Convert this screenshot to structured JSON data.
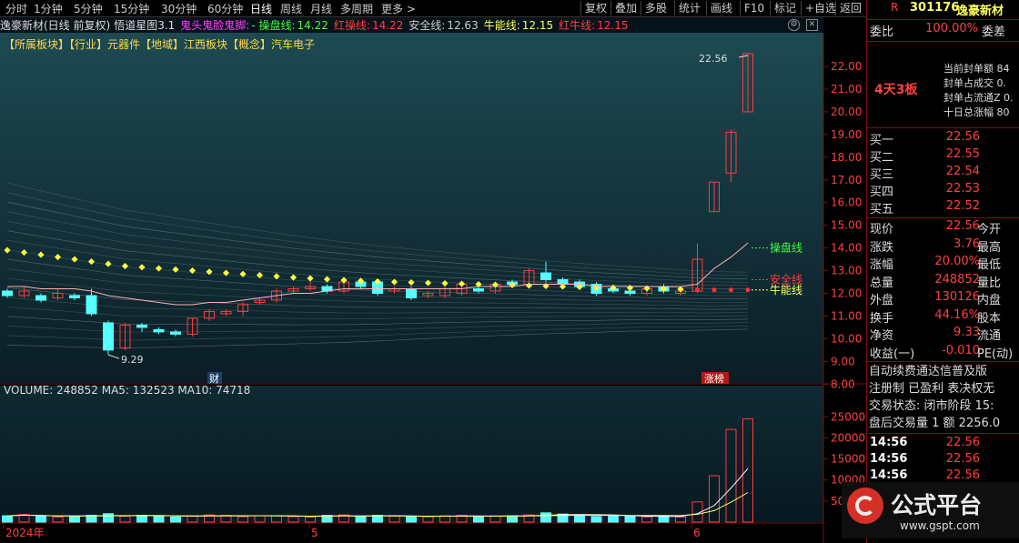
{
  "toolbar": {
    "periods": [
      "分时",
      "1分钟",
      "5分钟",
      "15分钟",
      "30分钟",
      "60分钟",
      "日线",
      "周线",
      "月线",
      "多周期",
      "更多 >"
    ],
    "buttons": [
      "复权",
      "叠加",
      "多股",
      "统计",
      "画线",
      "F10",
      "标记",
      "+自选",
      "返回"
    ]
  },
  "title": {
    "stock": "逸豪新材(日线 前复权)",
    "indicator": "悟道星图3.1",
    "formula_name": "鬼头鬼脸鬼脚:",
    "caopan_label": "- 操盘线:",
    "caopan_value": "14.22",
    "hongcao_label": "红操线:",
    "hongcao_value": "14.22",
    "anquan_label": "安全线:",
    "anquan_value": "12.63",
    "niuneng_label": "牛能线:",
    "niuneng_value": "12.15",
    "hongniu_label": "红牛线:",
    "hongniu_value": "12.15"
  },
  "tags": "【所属板块】【行业】元器件【地域】江西板块【概念】汽车电子",
  "chart_data": {
    "type": "candlestick",
    "price_axis": {
      "min": 8.0,
      "max": 22.0,
      "ticks": [
        "22.00",
        "21.00",
        "20.00",
        "19.00",
        "18.00",
        "17.00",
        "16.00",
        "15.00",
        "14.00",
        "13.00",
        "12.00",
        "11.00",
        "10.00",
        "9.00",
        "8.00"
      ]
    },
    "candles": [
      {
        "o": 12.1,
        "c": 11.9,
        "h": 12.2,
        "l": 11.8
      },
      {
        "o": 11.9,
        "c": 12.1,
        "h": 12.3,
        "l": 11.8
      },
      {
        "o": 11.9,
        "c": 11.7,
        "h": 12.0,
        "l": 11.6
      },
      {
        "o": 11.8,
        "c": 12.0,
        "h": 12.2,
        "l": 11.7
      },
      {
        "o": 11.9,
        "c": 11.8,
        "h": 12.0,
        "l": 11.7
      },
      {
        "o": 11.9,
        "c": 11.1,
        "h": 12.2,
        "l": 11.0
      },
      {
        "o": 10.7,
        "c": 9.5,
        "h": 10.8,
        "l": 9.3
      },
      {
        "o": 9.6,
        "c": 10.6,
        "h": 10.7,
        "l": 9.5
      },
      {
        "o": 10.6,
        "c": 10.5,
        "h": 10.7,
        "l": 10.3
      },
      {
        "o": 10.4,
        "c": 10.3,
        "h": 10.5,
        "l": 10.2
      },
      {
        "o": 10.3,
        "c": 10.2,
        "h": 10.4,
        "l": 10.1
      },
      {
        "o": 10.2,
        "c": 10.9,
        "h": 10.9,
        "l": 10.1
      },
      {
        "o": 10.9,
        "c": 11.2,
        "h": 11.3,
        "l": 10.8
      },
      {
        "o": 11.1,
        "c": 11.2,
        "h": 11.3,
        "l": 11.0
      },
      {
        "o": 11.2,
        "c": 11.5,
        "h": 11.6,
        "l": 11.0
      },
      {
        "o": 11.6,
        "c": 11.7,
        "h": 11.8,
        "l": 11.5
      },
      {
        "o": 11.7,
        "c": 12.1,
        "h": 12.2,
        "l": 11.6
      },
      {
        "o": 12.1,
        "c": 12.2,
        "h": 12.3,
        "l": 12.0
      },
      {
        "o": 12.2,
        "c": 12.3,
        "h": 12.5,
        "l": 12.1
      },
      {
        "o": 12.3,
        "c": 12.1,
        "h": 12.4,
        "l": 12.0
      },
      {
        "o": 12.1,
        "c": 12.5,
        "h": 12.6,
        "l": 12.0
      },
      {
        "o": 12.5,
        "c": 12.3,
        "h": 12.6,
        "l": 12.2
      },
      {
        "o": 12.5,
        "c": 12.0,
        "h": 12.6,
        "l": 11.9
      },
      {
        "o": 12.1,
        "c": 12.2,
        "h": 12.3,
        "l": 12.0
      },
      {
        "o": 12.2,
        "c": 11.8,
        "h": 12.3,
        "l": 11.7
      },
      {
        "o": 11.9,
        "c": 12.0,
        "h": 12.1,
        "l": 11.8
      },
      {
        "o": 11.9,
        "c": 12.2,
        "h": 12.3,
        "l": 11.8
      },
      {
        "o": 12.0,
        "c": 12.4,
        "h": 12.5,
        "l": 11.9
      },
      {
        "o": 12.2,
        "c": 12.1,
        "h": 12.3,
        "l": 12.0
      },
      {
        "o": 12.1,
        "c": 12.4,
        "h": 12.5,
        "l": 12.0
      },
      {
        "o": 12.5,
        "c": 12.4,
        "h": 12.6,
        "l": 12.3
      },
      {
        "o": 12.4,
        "c": 13.0,
        "h": 13.1,
        "l": 12.3
      },
      {
        "o": 12.9,
        "c": 12.6,
        "h": 13.4,
        "l": 12.5
      },
      {
        "o": 12.6,
        "c": 12.4,
        "h": 12.7,
        "l": 12.2
      },
      {
        "o": 12.5,
        "c": 12.3,
        "h": 12.6,
        "l": 12.2
      },
      {
        "o": 12.4,
        "c": 12.0,
        "h": 12.5,
        "l": 11.9
      },
      {
        "o": 12.2,
        "c": 12.1,
        "h": 12.3,
        "l": 12.0
      },
      {
        "o": 12.1,
        "c": 12.0,
        "h": 12.2,
        "l": 11.9
      },
      {
        "o": 12.0,
        "c": 12.2,
        "h": 12.3,
        "l": 11.9
      },
      {
        "o": 12.3,
        "c": 12.1,
        "h": 12.4,
        "l": 12.0
      },
      {
        "o": 12.0,
        "c": 12.1,
        "h": 12.2,
        "l": 11.9
      },
      {
        "o": 12.1,
        "c": 13.5,
        "h": 14.2,
        "l": 12.0
      },
      {
        "o": 15.6,
        "c": 16.9,
        "h": 16.9,
        "l": 15.6
      },
      {
        "o": 17.3,
        "c": 19.1,
        "h": 19.2,
        "l": 16.9
      },
      {
        "o": 20.0,
        "c": 22.56,
        "h": 22.56,
        "l": 20.0
      }
    ],
    "caopan_line": [
      12.3,
      12.3,
      12.2,
      12.2,
      12.2,
      12.1,
      11.9,
      11.8,
      11.7,
      11.6,
      11.5,
      11.5,
      11.6,
      11.6,
      11.7,
      11.8,
      11.9,
      12.0,
      12.0,
      12.1,
      12.2,
      12.2,
      12.2,
      12.2,
      12.2,
      12.2,
      12.2,
      12.2,
      12.3,
      12.3,
      12.3,
      12.4,
      12.4,
      12.4,
      12.4,
      12.3,
      12.3,
      12.3,
      12.3,
      12.3,
      12.3,
      12.4,
      13.1,
      13.6,
      14.22
    ],
    "dotted_line": [
      13.9,
      13.8,
      13.7,
      13.6,
      13.5,
      13.4,
      13.3,
      13.2,
      13.15,
      13.1,
      13.05,
      13.0,
      12.95,
      12.9,
      12.85,
      12.8,
      12.75,
      12.7,
      12.66,
      12.62,
      12.58,
      12.55,
      12.52,
      12.5,
      12.48,
      12.46,
      12.44,
      12.42,
      12.4,
      12.38,
      12.36,
      12.34,
      12.32,
      12.3,
      12.28,
      12.26,
      12.25,
      12.24,
      12.22,
      12.2,
      12.18,
      12.16,
      12.15,
      12.15,
      12.15
    ],
    "annotations": {
      "low_label": "9.29",
      "high_label": "22.56",
      "caopan_tag": "操盘线",
      "anquan_tag": "安全线",
      "niuneng_tag": "牛能线",
      "cai_marker": "财",
      "zhangting_marker": "涨榜"
    },
    "volume": {
      "legend": "VOLUME: 248852  MA5: 132523  MA10: 74718",
      "axis_ticks": [
        "25000",
        "20000",
        "15000",
        "10000",
        "5000"
      ],
      "max": 27000,
      "values": [
        1500,
        1800,
        1400,
        1200,
        1300,
        1600,
        2000,
        1400,
        1600,
        1300,
        1200,
        1500,
        1700,
        1600,
        1300,
        1500,
        1500,
        1300,
        1200,
        1600,
        1700,
        1300,
        1600,
        1400,
        1200,
        1300,
        1500,
        1600,
        1300,
        1400,
        1500,
        1700,
        2200,
        1900,
        1600,
        1300,
        1500,
        1400,
        1200,
        1400,
        1200,
        4800,
        11000,
        22000,
        24500
      ],
      "up": [
        false,
        true,
        false,
        true,
        false,
        false,
        false,
        true,
        false,
        false,
        false,
        true,
        true,
        true,
        true,
        true,
        true,
        true,
        true,
        false,
        true,
        false,
        false,
        true,
        false,
        true,
        true,
        true,
        false,
        true,
        false,
        true,
        false,
        false,
        false,
        false,
        false,
        false,
        true,
        false,
        true,
        true,
        true,
        true,
        true
      ]
    },
    "x_labels": [
      "2024年",
      "5",
      "6"
    ]
  },
  "right_panel": {
    "code": "301176",
    "name": "逸豪新材",
    "weibi_label": "委比",
    "weibi_value": "100.00%",
    "weicha_label": "委差",
    "board_label": "4天3板",
    "fengdan": [
      "当前封单额 84",
      "封单占成交 0.",
      "封单占流通Z 0.",
      "十日总涨幅 80"
    ],
    "buy_levels": [
      {
        "label": "买一",
        "price": "22.56"
      },
      {
        "label": "买二",
        "price": "22.55"
      },
      {
        "label": "买三",
        "price": "22.54"
      },
      {
        "label": "买四",
        "price": "22.53"
      },
      {
        "label": "买五",
        "price": "22.52"
      }
    ],
    "quote_rows": [
      {
        "l1": "现价",
        "v": "22.56",
        "l2": "今开"
      },
      {
        "l1": "涨跌",
        "v": "3.76",
        "l2": "最高"
      },
      {
        "l1": "涨幅",
        "v": "20.00%",
        "l2": "最低"
      },
      {
        "l1": "总量",
        "v": "248852",
        "l2": "量比"
      },
      {
        "l1": "外盘",
        "v": "130126",
        "l2": "内盘"
      },
      {
        "l1": "换手",
        "v": "44.16%",
        "l2": "股本"
      },
      {
        "l1": "净资",
        "v": "9.33",
        "l2": "流通"
      },
      {
        "l1": "收益(一)",
        "v": "-0.010",
        "l2": "PE(动)"
      }
    ],
    "info_lines": [
      "自动续费通达信普及版",
      "注册制 已盈利 表决权无",
      "交易状态: 闭市阶段 15:",
      "盘后交易量 1 额 2256.0"
    ],
    "ticks": [
      {
        "time": "14:56",
        "price": "22.56"
      },
      {
        "time": "14:56",
        "price": "22.56"
      },
      {
        "time": "14:56",
        "price": "22.56"
      }
    ]
  },
  "watermark": {
    "text": "公式平台",
    "url": "www.gspt.com"
  },
  "colors": {
    "up": "#ff3c3c",
    "down": "#54ffff",
    "bg_top": "#1d4a52",
    "bg_bottom": "#0a1a22",
    "dot": "#ffff3c",
    "caopan": "#ffb3b3"
  }
}
